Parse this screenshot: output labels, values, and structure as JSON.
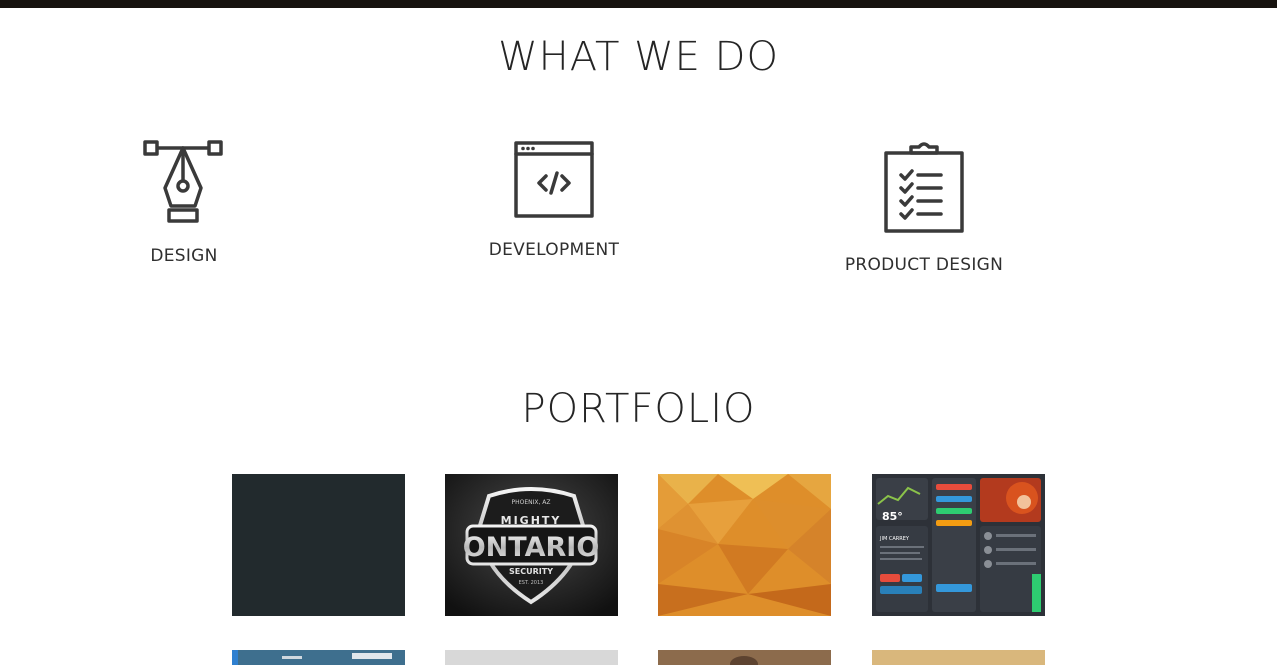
{
  "sections": {
    "what_we_do_title": "WHAT WE DO",
    "portfolio_title": "PORTFOLIO"
  },
  "services": [
    {
      "label": "DESIGN",
      "icon": "pen-tool-icon"
    },
    {
      "label": "DEVELOPMENT",
      "icon": "code-window-icon"
    },
    {
      "label": "PRODUCT DESIGN",
      "icon": "clipboard-checklist-icon"
    }
  ],
  "portfolio": {
    "items": [
      {
        "name": "portfolio-dark-slate",
        "color": "#222a2d"
      },
      {
        "name": "portfolio-ontario-logo",
        "logo_text": {
          "top": "PHOENIX, AZ",
          "mid": "MIGHTY",
          "main": "ONTARIO",
          "sub": "SECURITY",
          "est": "EST. 2013"
        }
      },
      {
        "name": "portfolio-orange-polygon",
        "color": "#e0902c"
      },
      {
        "name": "portfolio-dashboard-ui",
        "readout": "85°",
        "heading": "JIM CARREY"
      },
      {
        "name": "portfolio-landscape",
        "color": "#3a6b8c"
      },
      {
        "name": "portfolio-light-gray",
        "color": "#d8d8d8"
      },
      {
        "name": "portfolio-brown-wood",
        "color": "#8a6a4a"
      },
      {
        "name": "portfolio-tan-paper",
        "color": "#d9b77c"
      }
    ]
  },
  "colors": {
    "top_bar": "#17130f",
    "text": "#252525",
    "icon_stroke": "#3a3a3a"
  }
}
